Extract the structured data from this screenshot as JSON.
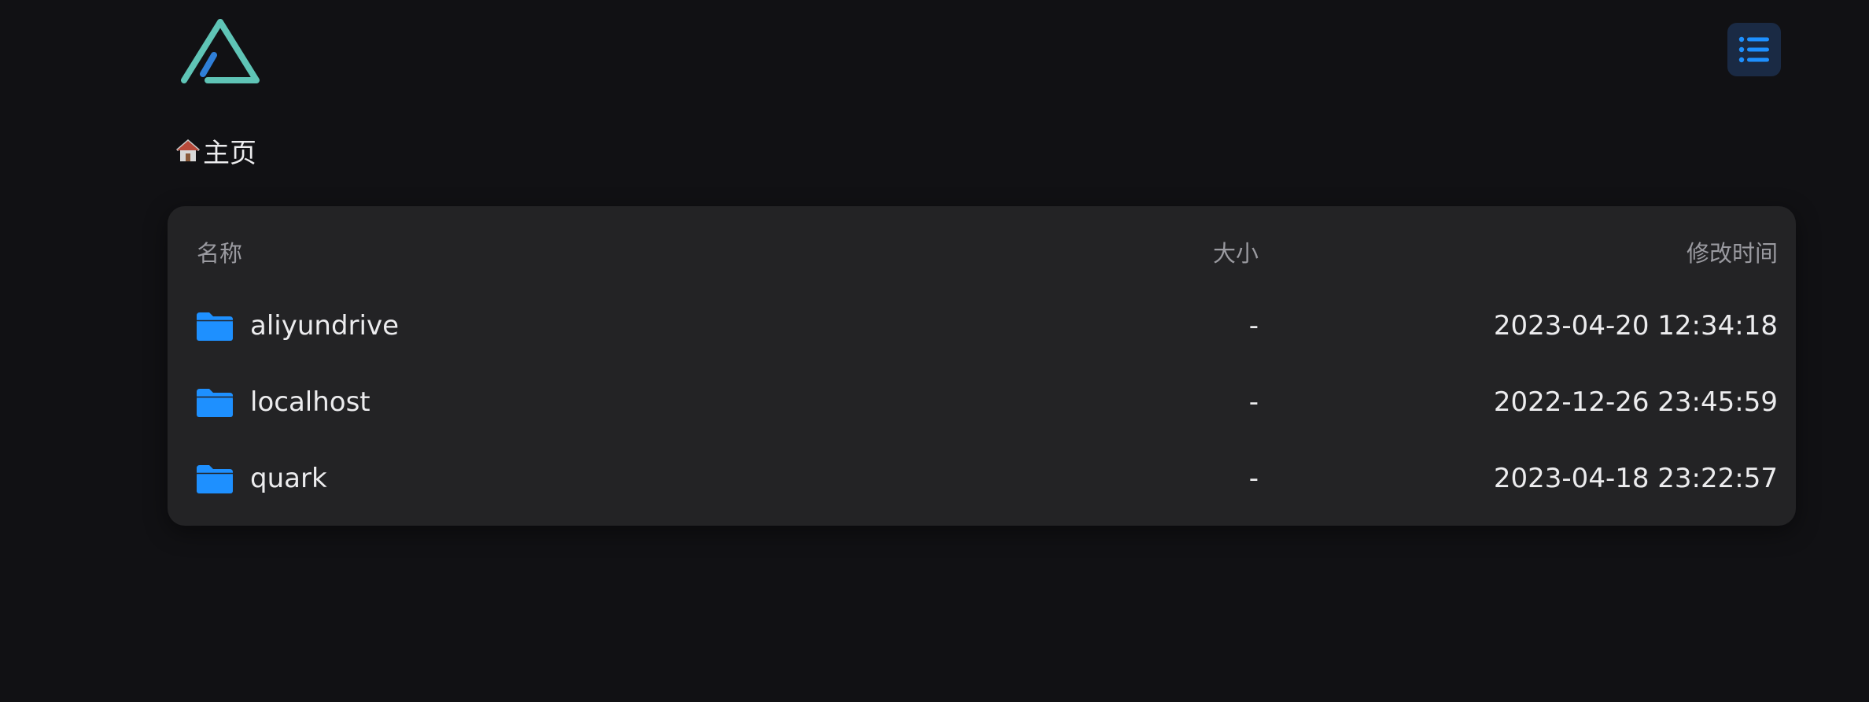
{
  "header": {
    "logo_icon": "alist-logo-icon",
    "layout_toggle_icon": "list-layout-icon",
    "accent_color": "#1e90ff"
  },
  "breadcrumb": {
    "home_icon": "house-icon",
    "home_label": "主页"
  },
  "table": {
    "columns": {
      "name": "名称",
      "size": "大小",
      "modified": "修改时间"
    },
    "rows": [
      {
        "icon": "folder-icon",
        "name": "aliyundrive",
        "size": "-",
        "modified": "2023-04-20 12:34:18"
      },
      {
        "icon": "folder-icon",
        "name": "localhost",
        "size": "-",
        "modified": "2022-12-26 23:45:59"
      },
      {
        "icon": "folder-icon",
        "name": "quark",
        "size": "-",
        "modified": "2023-04-18 23:22:57"
      }
    ]
  }
}
